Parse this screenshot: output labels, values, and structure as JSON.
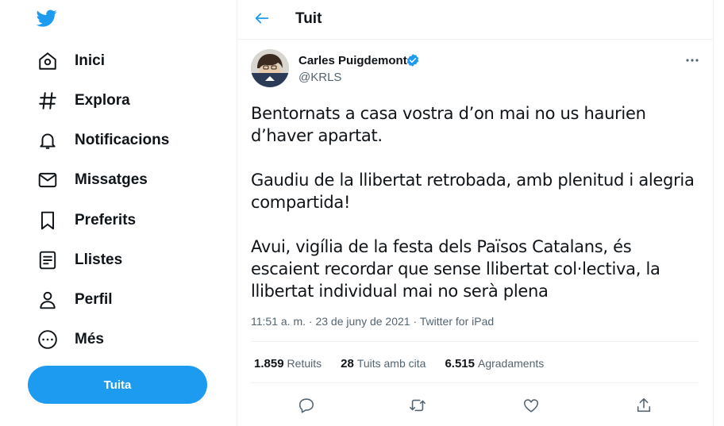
{
  "sidebar": {
    "items": [
      {
        "label": "Inici",
        "icon": "home-icon"
      },
      {
        "label": "Explora",
        "icon": "hashtag-icon"
      },
      {
        "label": "Notificacions",
        "icon": "bell-icon"
      },
      {
        "label": "Missatges",
        "icon": "envelope-icon"
      },
      {
        "label": "Preferits",
        "icon": "bookmark-icon"
      },
      {
        "label": "Llistes",
        "icon": "list-icon"
      },
      {
        "label": "Perfil",
        "icon": "person-icon"
      },
      {
        "label": "Més",
        "icon": "more-circle-icon"
      }
    ],
    "tweet_button": "Tuita"
  },
  "header": {
    "title": "Tuit"
  },
  "tweet": {
    "author_name": "Carles Puigdemont",
    "handle": "@KRLS",
    "paragraphs": [
      "Bentornats a casa vostra d’on mai no us haurien d’haver apartat.",
      "Gaudiu de la llibertat retrobada, amb plenitud i alegria compartida!",
      "Avui, vigília de la festa dels Països Catalans, és escaient recordar que sense llibertat col·lectiva, la llibertat individual mai no serà plena"
    ],
    "time": "11:51 a. m.",
    "dot": " · ",
    "date": "23 de juny de 2021",
    "source": "Twitter for iPad",
    "stats": {
      "retweets_count": "1.859",
      "retweets_label": "Retuits",
      "quotes_count": "28",
      "quotes_label": "Tuits amb cita",
      "likes_count": "6.515",
      "likes_label": "Agradaments"
    }
  },
  "colors": {
    "accent": "#1d9bf0",
    "text": "#0f1419",
    "secondary": "#536471",
    "border": "#eff3f4"
  }
}
